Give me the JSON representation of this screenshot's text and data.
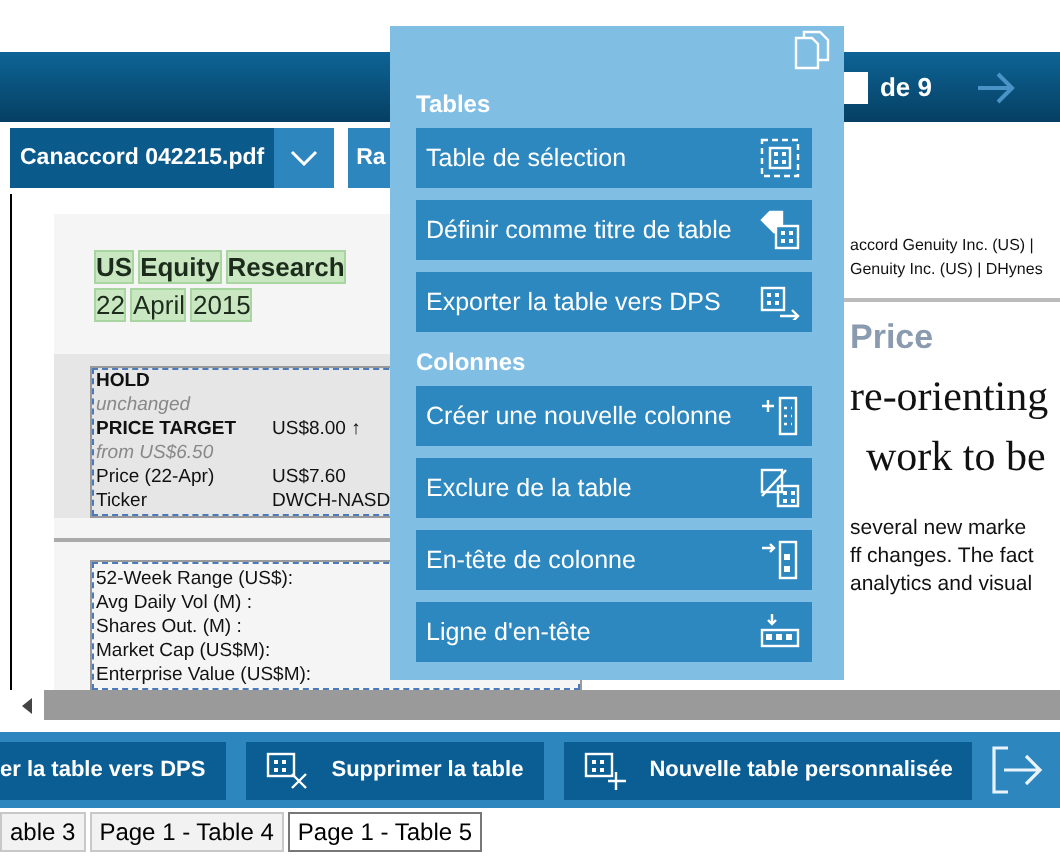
{
  "header": {
    "page_total": "de 9"
  },
  "toolbar": {
    "file": "Canaccord 042215.pdf",
    "next_button": "Ra"
  },
  "document": {
    "left": {
      "title_words": [
        "US",
        "Equity",
        "Research"
      ],
      "date_words": [
        "22",
        "April",
        "2015"
      ],
      "rating_rows": [
        {
          "kind": "bold",
          "label": "HOLD"
        },
        {
          "kind": "note",
          "label": "unchanged"
        },
        {
          "kind": "bold",
          "label": "PRICE TARGET",
          "value": "US$8.00 ↑"
        },
        {
          "kind": "note",
          "label": "from US$6.50"
        },
        {
          "kind": "plain",
          "label": "Price (22-Apr)",
          "value": "US$7.60"
        },
        {
          "kind": "plain",
          "label": "Ticker",
          "value": "DWCH-NASD"
        }
      ],
      "stats_rows": [
        "52-Week Range (US$):",
        "Avg Daily Vol (M) :",
        "Shares Out. (M) :",
        "Market Cap (US$M):",
        "Enterprise Value (US$M):"
      ]
    },
    "right": {
      "byline": [
        "accord Genuity Inc. (US)  |",
        "Genuity Inc. (US)  |  DHynes"
      ],
      "heading": "Price",
      "headline": [
        "re-orienting",
        "work to be"
      ],
      "body": [
        "several new marke",
        "ff changes. The fact",
        "analytics and visual"
      ]
    }
  },
  "menu": {
    "sections": [
      {
        "title": "Tables",
        "items": [
          {
            "label": "Table de sélection",
            "kind": "select"
          },
          {
            "label": "Définir comme titre de table",
            "kind": "tag"
          },
          {
            "label": "Exporter la table vers DPS",
            "kind": "export"
          }
        ]
      },
      {
        "title": "Colonnes",
        "items": [
          {
            "label": "Créer une nouvelle colonne",
            "kind": "add-column"
          },
          {
            "label": "Exclure de la table",
            "kind": "exclude"
          },
          {
            "label": "En-tête de colonne",
            "kind": "column-header"
          },
          {
            "label": "Ligne d'en-tête",
            "kind": "header-row"
          }
        ]
      }
    ]
  },
  "actions": [
    {
      "label": "er la table vers DPS",
      "kind": "none"
    },
    {
      "label": "Supprimer la table",
      "kind": "delete"
    },
    {
      "label": "Nouvelle table personnalisée",
      "kind": "new"
    }
  ],
  "tabs": [
    {
      "label": "able 3",
      "selected": false
    },
    {
      "label": "Page 1 - Table 4",
      "selected": false
    },
    {
      "label": "Page 1 - Table 5",
      "selected": true
    }
  ]
}
